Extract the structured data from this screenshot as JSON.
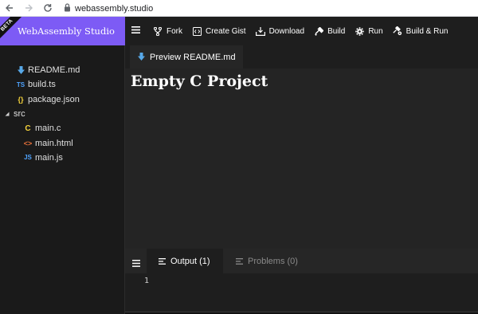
{
  "browser": {
    "url": "webassembly.studio"
  },
  "brand": {
    "badge": "BETA",
    "title": "WebAssembly Studio"
  },
  "toolbar": {
    "fork": "Fork",
    "create_gist": "Create Gist",
    "download": "Download",
    "build": "Build",
    "run": "Run",
    "build_and_run": "Build & Run"
  },
  "tree": {
    "readme": {
      "name": "README.md",
      "icon": "markdown-icon"
    },
    "build_ts": {
      "name": "build.ts",
      "icon_text": "TS"
    },
    "package_json": {
      "name": "package.json",
      "icon_text": "{}"
    },
    "src": {
      "name": "src"
    },
    "main_c": {
      "name": "main.c",
      "icon_text": "C"
    },
    "main_html": {
      "name": "main.html",
      "icon_text": "<>"
    },
    "main_js": {
      "name": "main.js",
      "icon_text": "JS"
    }
  },
  "editor": {
    "active_tab": "Preview README.md",
    "preview_heading": "Empty C Project"
  },
  "panel": {
    "output_tab": "Output (1)",
    "problems_tab": "Problems (0)",
    "line_number": "1"
  },
  "colors": {
    "brand": "#7d5bf5",
    "ts": "#4ea3ff",
    "json": "#f5d33b",
    "c": "#f5d33b",
    "html": "#e8713a",
    "js": "#4ea3ff",
    "markdown": "#57a8e8"
  }
}
